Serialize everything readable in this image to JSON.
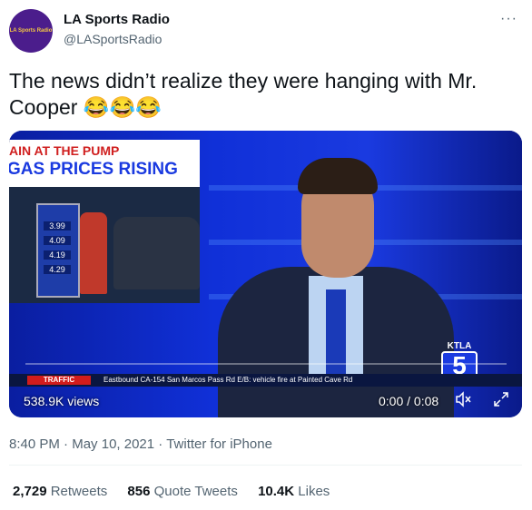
{
  "author": {
    "name": "LA Sports Radio",
    "handle": "@LASportsRadio",
    "avatar_text": "LA Sports Radio"
  },
  "more_label": "···",
  "tweet_text": "The news didn’t realize they were hanging with Mr. Cooper 😂😂😂",
  "video": {
    "inset_line1": "AIN AT THE PUMP",
    "inset_line2": "GAS PRICES RISING",
    "prices": [
      "3.99",
      "4.09",
      "4.19",
      "4.29"
    ],
    "traffic_label": "TRAFFIC",
    "ticker": "Eastbound CA-154 San Marcos Pass Rd E/B: vehicle fire at Painted Cave Rd",
    "station_name": "KTLA",
    "station_number": "5",
    "views": "538.9K views",
    "time": "0:00 / 0:08",
    "progress": 0.0,
    "mute_icon": "speaker-muted-icon",
    "fullscreen_icon": "fullscreen-icon"
  },
  "meta": {
    "time": "8:40 PM",
    "date": "May 10, 2021",
    "source": "Twitter for iPhone"
  },
  "stats": {
    "retweets_count": "2,729",
    "retweets_label": "Retweets",
    "quotes_count": "856",
    "quotes_label": "Quote Tweets",
    "likes_count": "10.4K",
    "likes_label": "Likes"
  },
  "colors": {
    "avatar_bg": "#4b1d8c",
    "secondary_text": "#536471",
    "primary_text": "#0f1419"
  }
}
